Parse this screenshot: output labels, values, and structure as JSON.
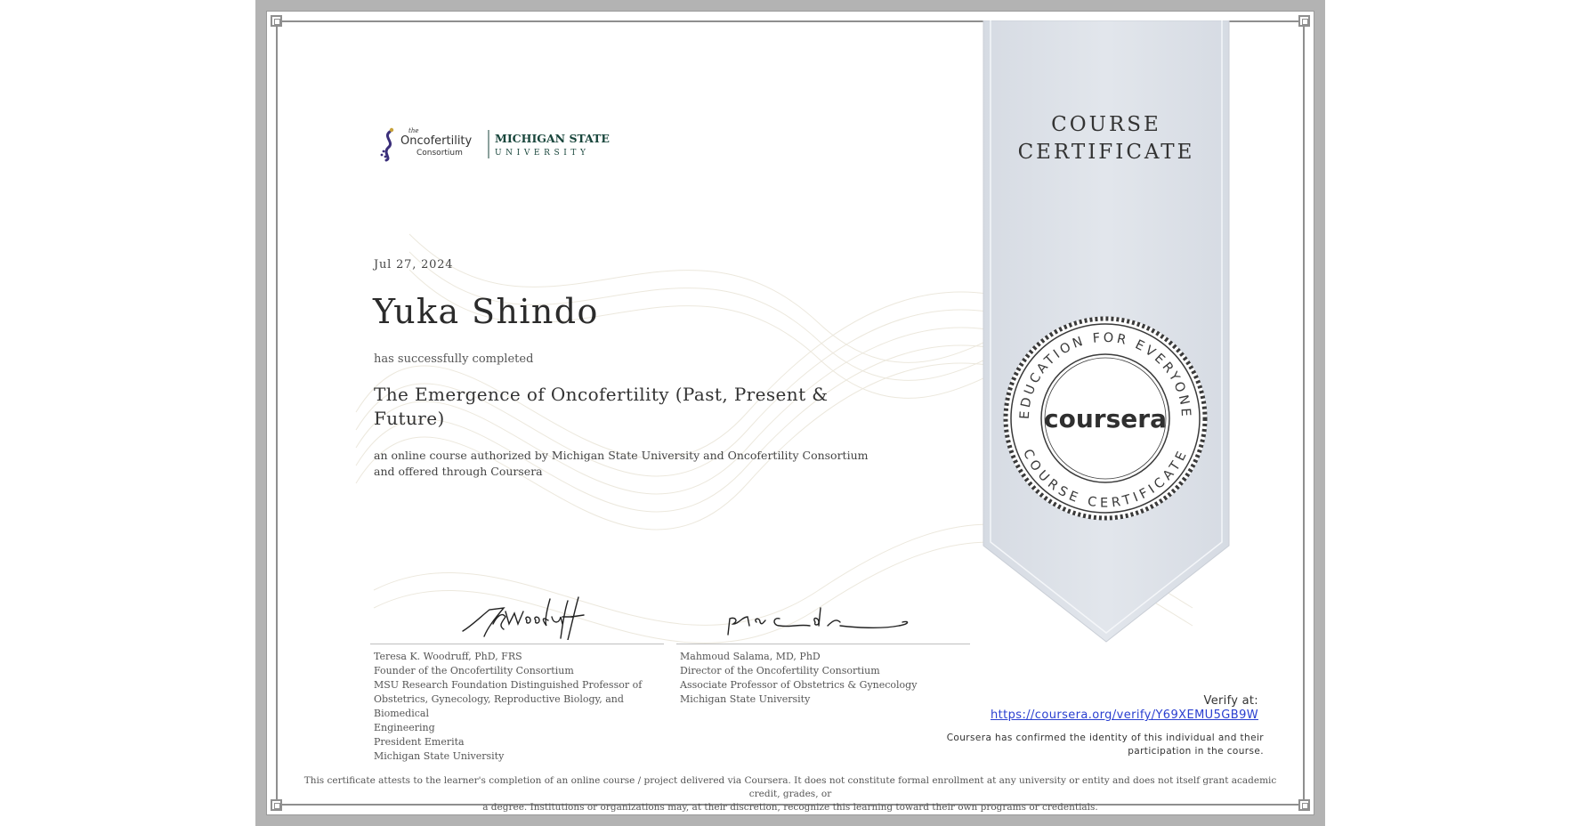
{
  "certificate": {
    "date": "Jul 27, 2024",
    "recipient_name": "Yuka Shindo",
    "completed_text": "has successfully completed",
    "course_title": "The Emergence of Oncofertility (Past, Present & Future)",
    "authorization_text": "an online course authorized by Michigan State University and Oncofertility Consortium and offered through Coursera"
  },
  "logo": {
    "the": "the",
    "oncofertility": "Oncofertility",
    "consortium": "Consortium",
    "university_top": "MICHIGAN STATE",
    "university_bottom": "UNIVERSITY"
  },
  "ribbon": {
    "line1": "COURSE",
    "line2": "CERTIFICATE"
  },
  "seal": {
    "top_text": "EDUCATION FOR EVERYONE",
    "bottom_text": "COURSE CERTIFICATE",
    "brand": "coursera"
  },
  "signatories": [
    {
      "lines": [
        "Teresa K. Woodruff, PhD, FRS",
        "Founder of the Oncofertility Consortium",
        "MSU Research Foundation Distinguished Professor of",
        "Obstetrics, Gynecology, Reproductive Biology, and Biomedical",
        "Engineering",
        "President Emerita",
        "Michigan State University"
      ]
    },
    {
      "lines": [
        "Mahmoud Salama, MD, PhD",
        "Director of the Oncofertility Consortium",
        "Associate Professor of Obstetrics & Gynecology",
        "Michigan State University"
      ]
    }
  ],
  "verification": {
    "label": "Verify at:",
    "url": "https://coursera.org/verify/Y69XEMU5GB9W",
    "identity_line1": "Coursera has confirmed the identity of this individual and their",
    "identity_line2": "participation in the course."
  },
  "disclaimer": {
    "line1": "This certificate attests to the learner's completion of an online course / project delivered via Coursera. It does not constitute formal enrollment at any university or entity and does not itself grant academic credit, grades, or",
    "line2": "a degree. Institutions or organizations may, at their discretion, recognize this learning toward their own programs or credentials."
  },
  "colors": {
    "frame_gray": "#b3b3b3",
    "ribbon_fill": "#dfe3ea",
    "link_blue": "#2a3fd0",
    "msu_green": "#18453b",
    "seal_dark": "#3a3a3a"
  }
}
